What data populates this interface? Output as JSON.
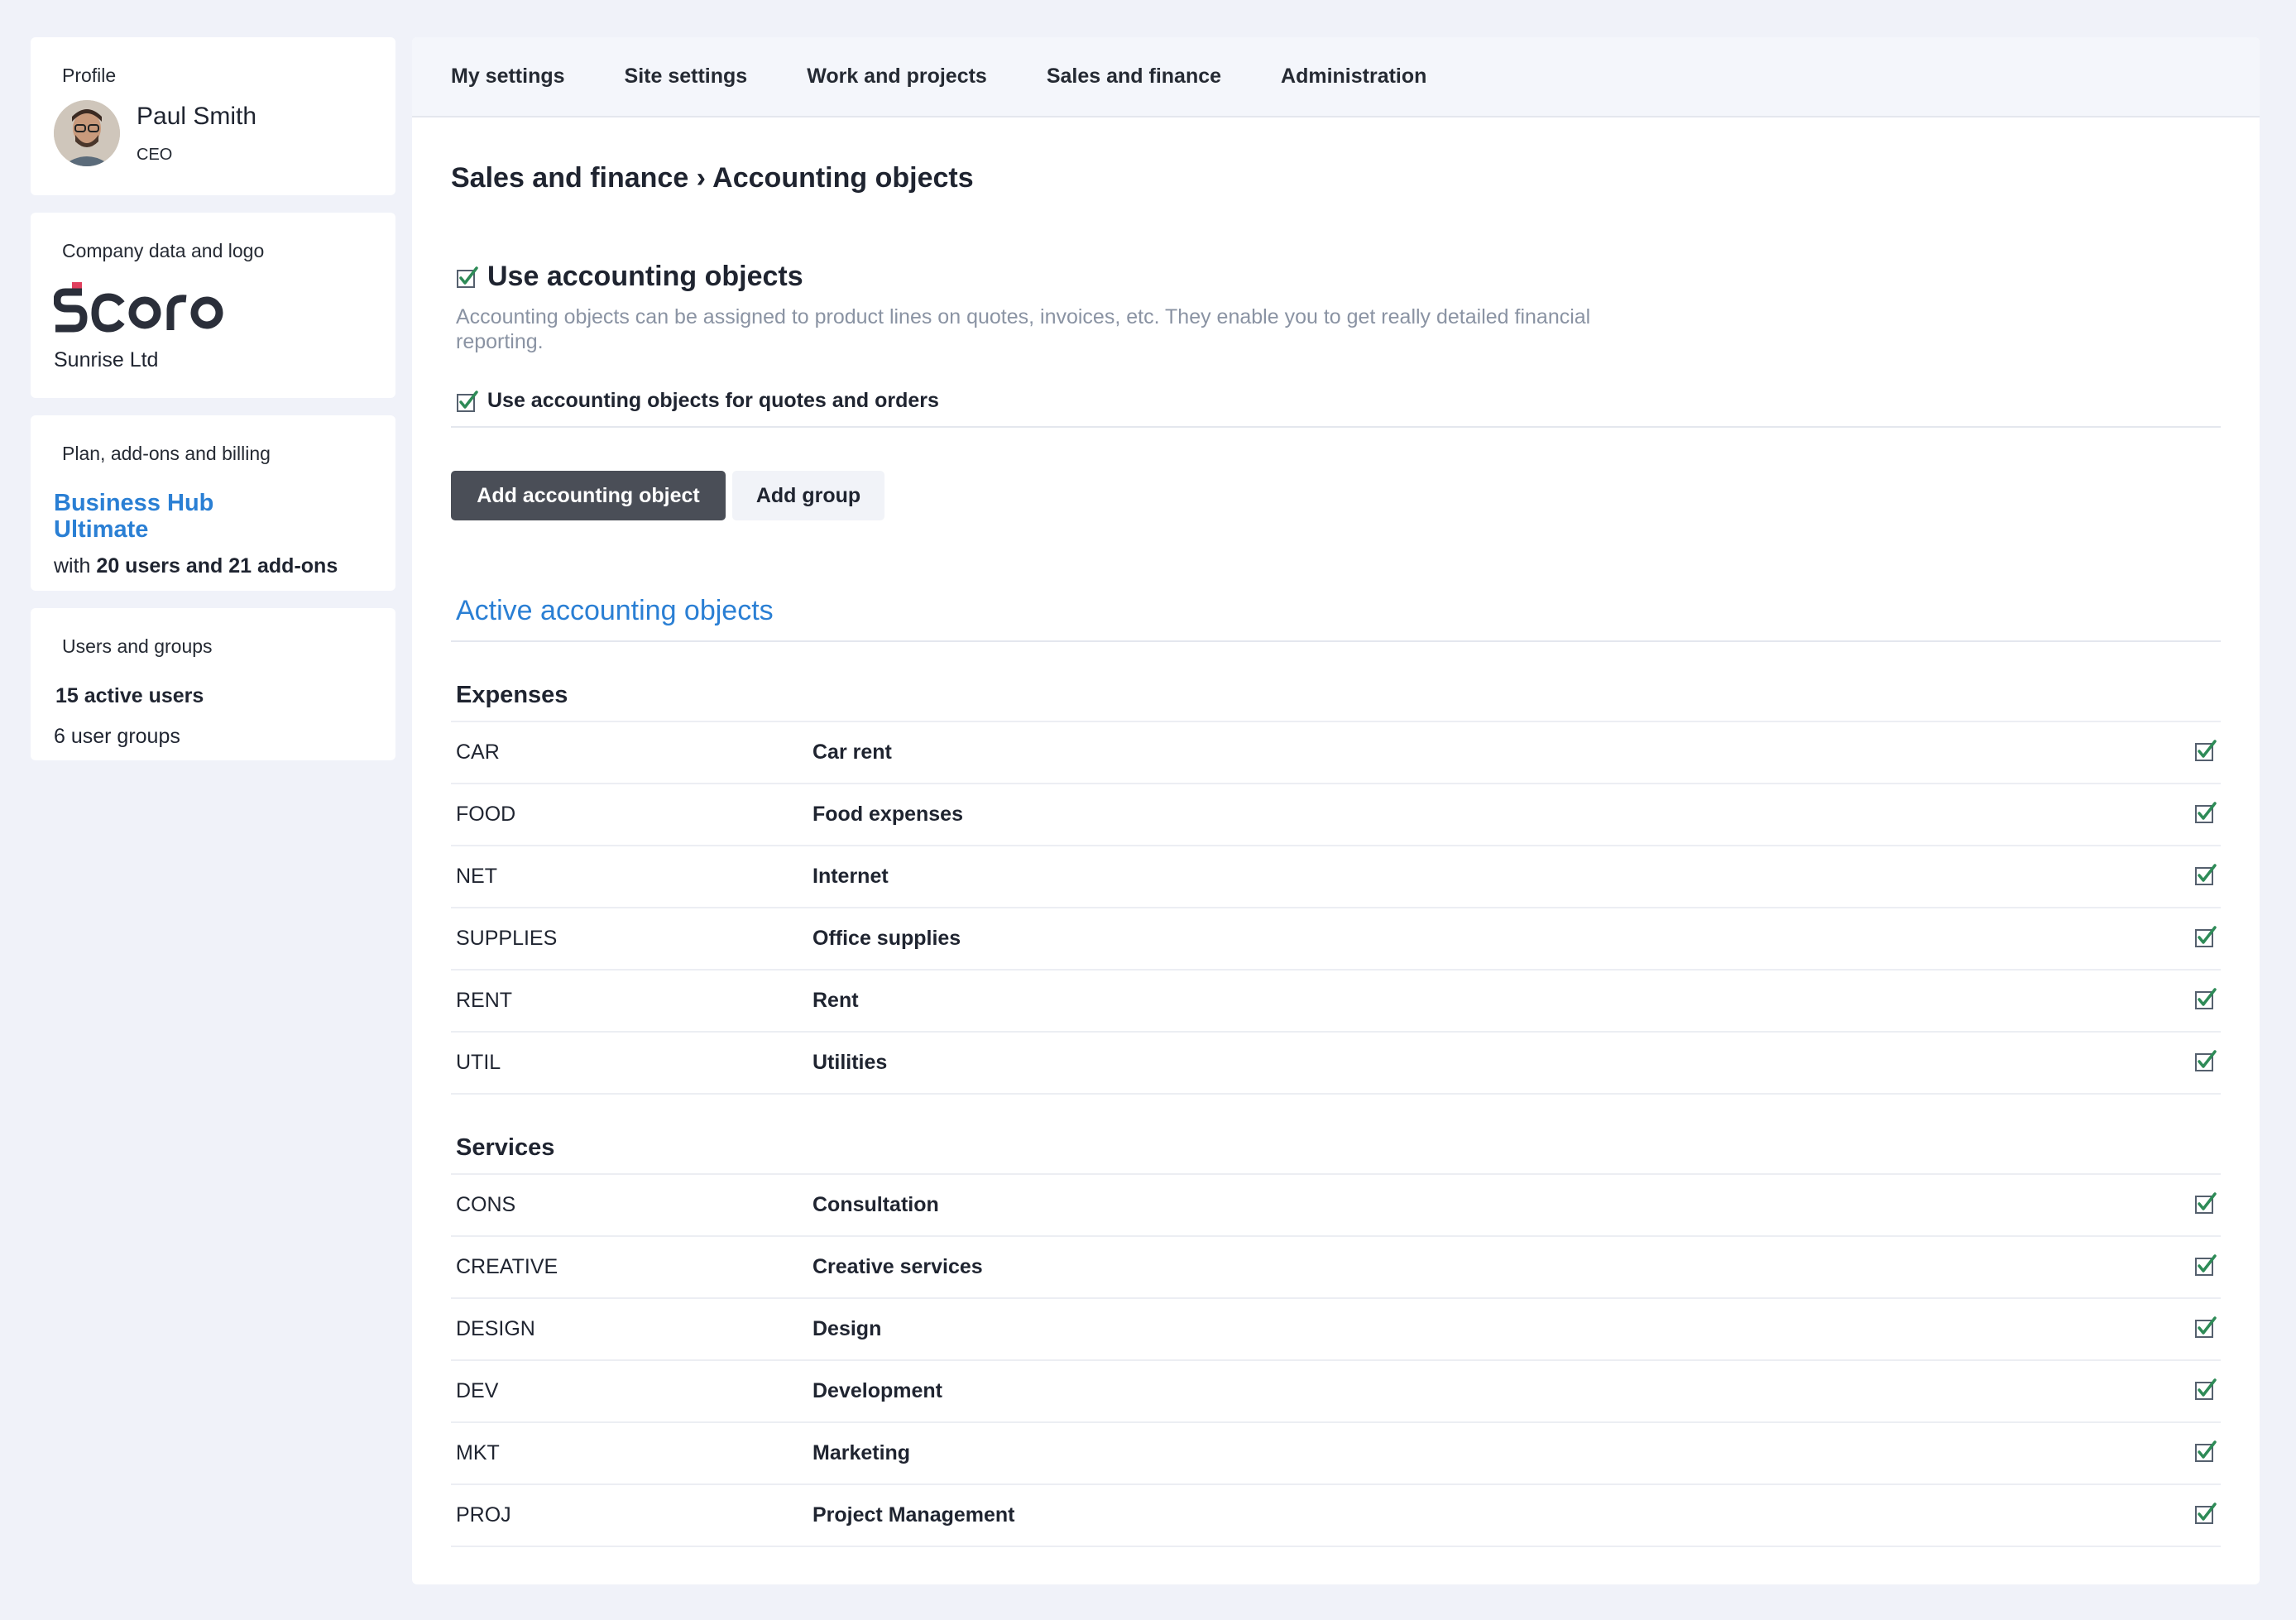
{
  "sidebar": {
    "profile": {
      "title": "Profile",
      "name": "Paul Smith",
      "role": "CEO"
    },
    "company": {
      "title": "Company data and logo",
      "logo": "Scoro",
      "name": "Sunrise Ltd"
    },
    "plan": {
      "title": "Plan, add-ons and billing",
      "name": "Business Hub Ultimate",
      "detail_prefix": "with",
      "users": "20 users",
      "detail_mid": "and",
      "addons": "21 add-ons"
    },
    "users": {
      "title": "Users and groups",
      "active": "15 active users",
      "groups": "6 user groups"
    }
  },
  "nav": [
    "My settings",
    "Site settings",
    "Work and projects",
    "Sales and finance",
    "Administration"
  ],
  "breadcrumb": "Sales and finance › Accounting objects",
  "option": {
    "title": "Use accounting objects",
    "description": "Accounting objects can be assigned to product lines on quotes, invoices, etc. They enable you to get really detailed financial reporting.",
    "sub": "Use accounting objects for quotes and orders"
  },
  "buttons": {
    "add_object": "Add accounting object",
    "add_group": "Add group"
  },
  "active_title": "Active accounting objects",
  "groups": [
    {
      "name": "Expenses",
      "rows": [
        {
          "code": "CAR",
          "name": "Car rent"
        },
        {
          "code": "FOOD",
          "name": "Food expenses"
        },
        {
          "code": "NET",
          "name": "Internet"
        },
        {
          "code": "SUPPLIES",
          "name": "Office supplies"
        },
        {
          "code": "RENT",
          "name": "Rent"
        },
        {
          "code": "UTIL",
          "name": "Utilities"
        }
      ]
    },
    {
      "name": "Services",
      "rows": [
        {
          "code": "CONS",
          "name": "Consultation"
        },
        {
          "code": "CREATIVE",
          "name": "Creative services"
        },
        {
          "code": "DESIGN",
          "name": "Design"
        },
        {
          "code": "DEV",
          "name": "Development"
        },
        {
          "code": "MKT",
          "name": "Marketing"
        },
        {
          "code": "PROJ",
          "name": "Project Management"
        }
      ]
    }
  ],
  "colors": {
    "accent": "#2a7fd4",
    "check": "#2e8b57",
    "primary_button": "#4a4e57",
    "logo_dark": "#2b2f3a",
    "logo_red": "#e0405e"
  }
}
